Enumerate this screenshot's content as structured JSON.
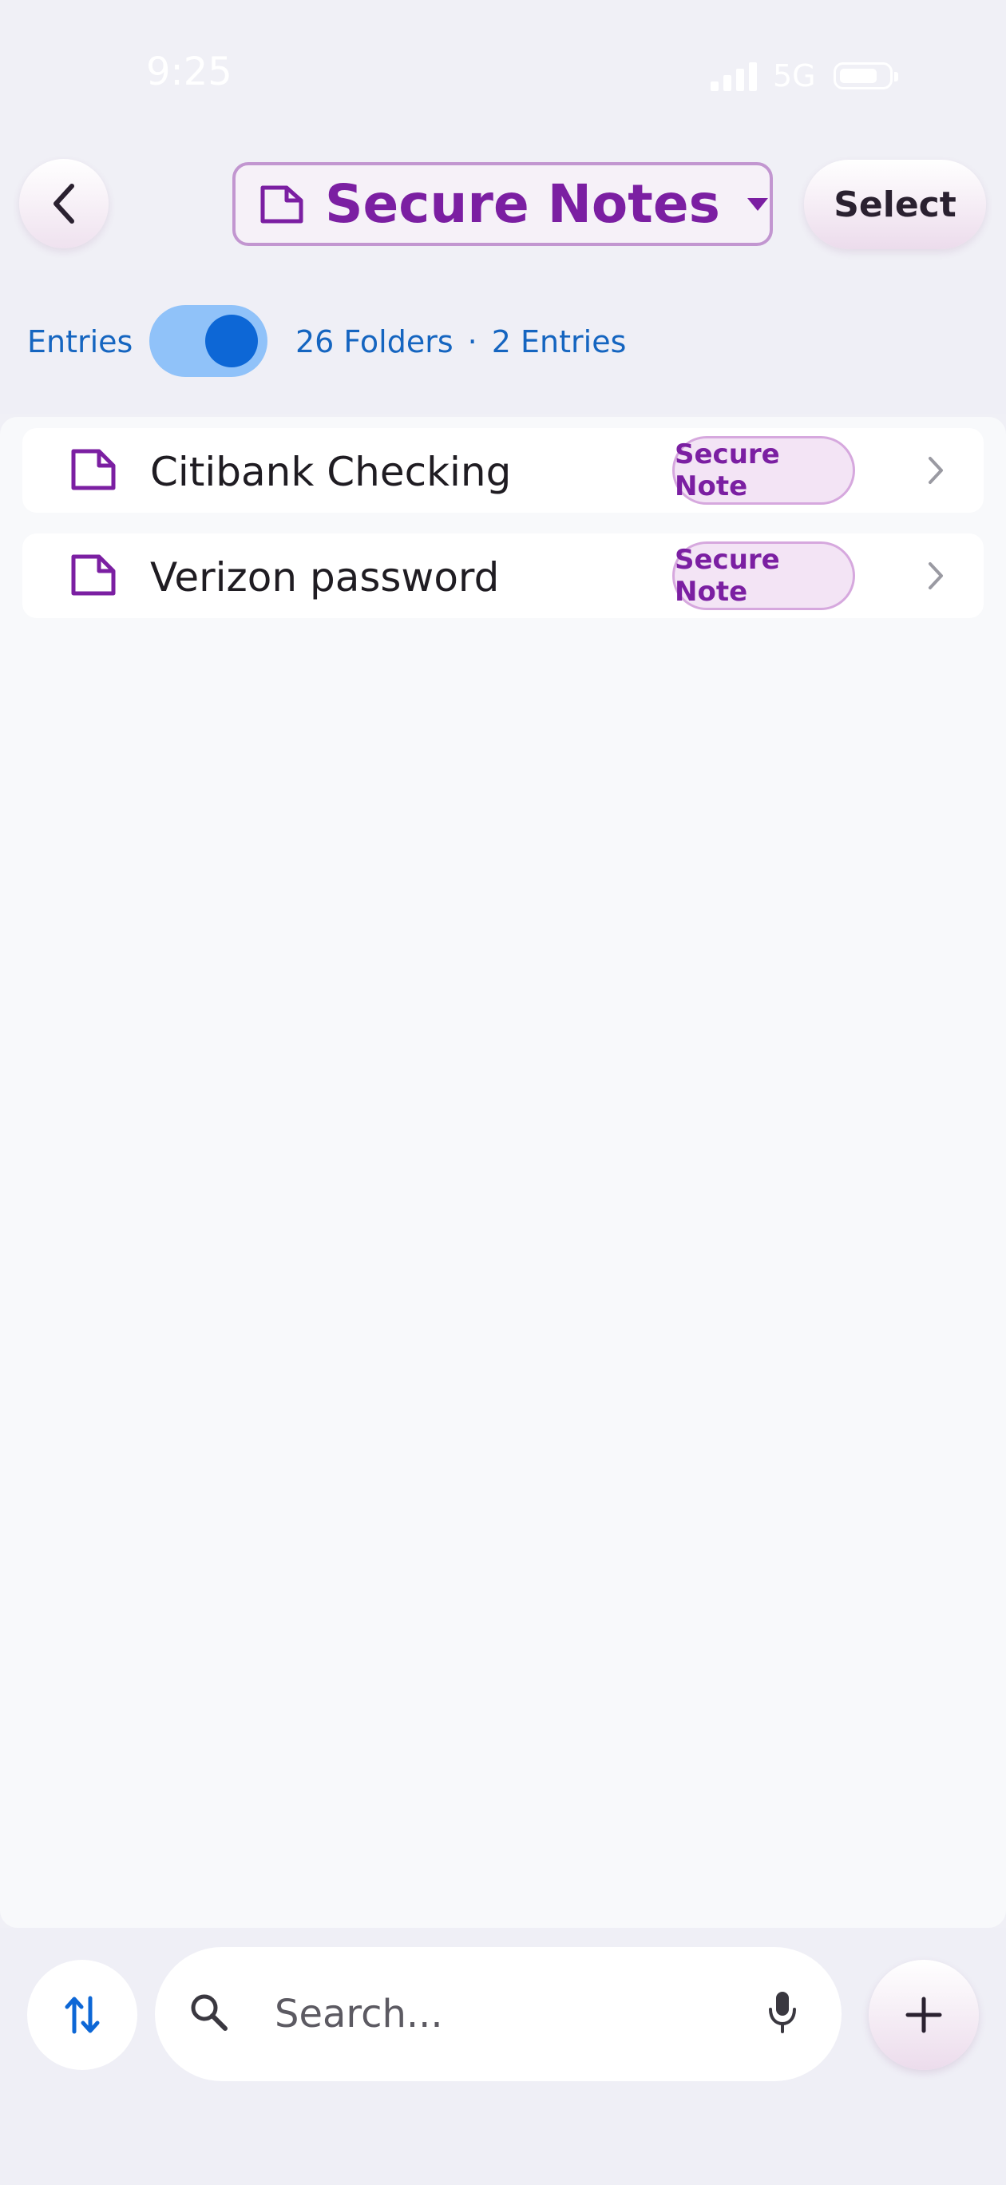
{
  "status_bar": {
    "time": "9:25",
    "network": "5G"
  },
  "header": {
    "title": "Secure Notes",
    "select_label": "Select"
  },
  "filter": {
    "entries_label": "Entries",
    "folders_count": "26 Folders",
    "separator": "·",
    "entries_count": "2 Entries"
  },
  "entries": [
    {
      "title": "Citibank Checking",
      "badge": "Secure Note"
    },
    {
      "title": "Verizon password",
      "badge": "Secure Note"
    }
  ],
  "search": {
    "placeholder": "Search..."
  },
  "colors": {
    "accent_purple": "#7b1fa2",
    "link_blue": "#1565c0",
    "toggle_on": "#0d67d6"
  }
}
